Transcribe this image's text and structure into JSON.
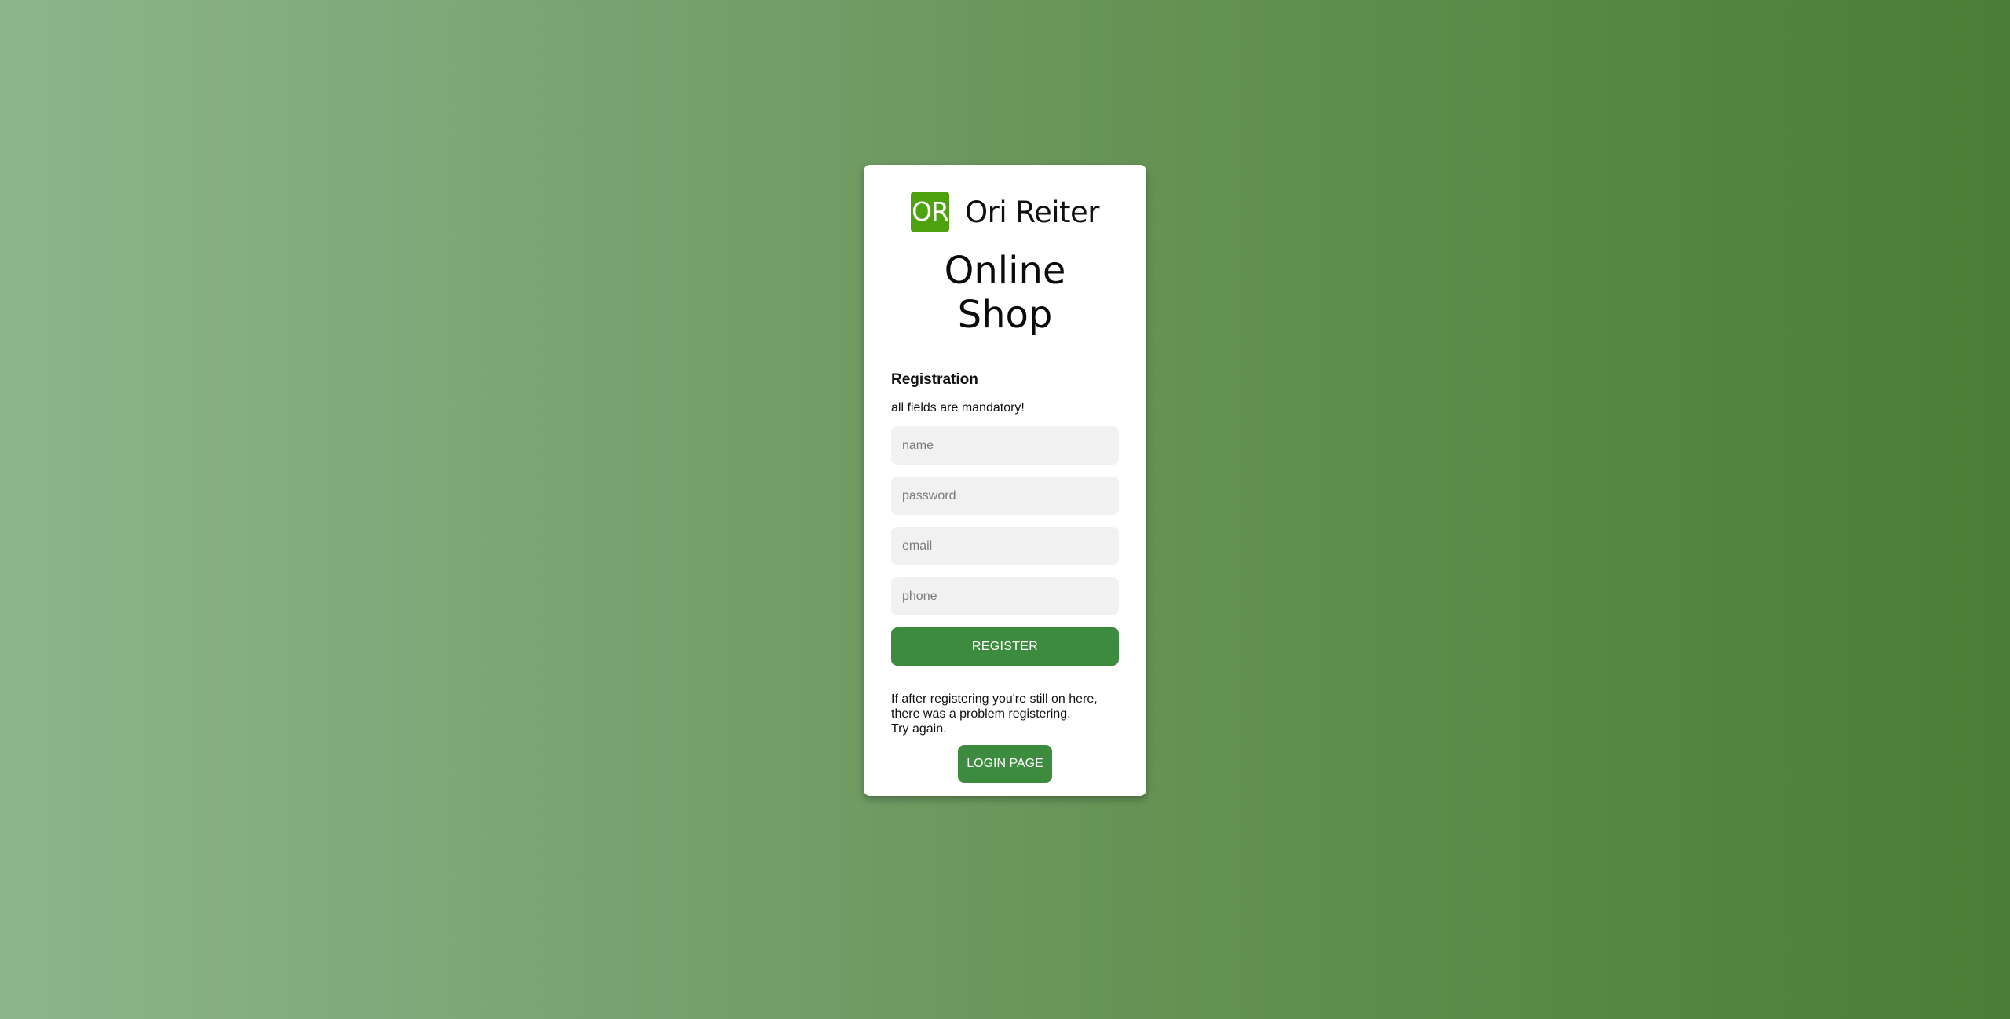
{
  "brand": {
    "logo_text": "OR",
    "name": "Ori Reiter"
  },
  "title": {
    "line1": "Online",
    "line2": "Shop"
  },
  "form": {
    "heading": "Registration",
    "note": "all fields are mandatory!",
    "fields": {
      "name": {
        "placeholder": "name",
        "value": ""
      },
      "password": {
        "placeholder": "password",
        "value": ""
      },
      "email": {
        "placeholder": "email",
        "value": ""
      },
      "phone": {
        "placeholder": "phone",
        "value": ""
      }
    },
    "register_label": "REGISTER"
  },
  "footer": {
    "line1": "If after registering you're still on here,",
    "line2": "there was a problem registering.",
    "line3": "Try again.",
    "login_label": "LOGIN PAGE"
  },
  "colors": {
    "accent": "#3c8b3f",
    "logo": "#4ea10f",
    "field_bg": "#f1f1f1"
  }
}
